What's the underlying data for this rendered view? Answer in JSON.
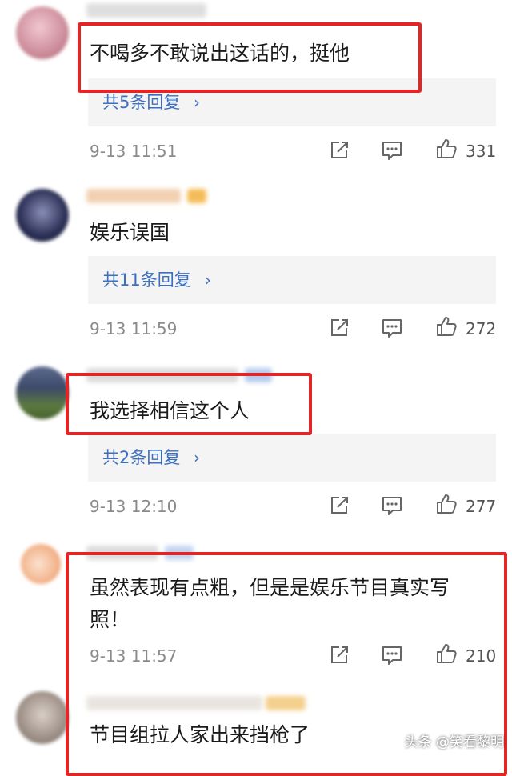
{
  "comments": [
    {
      "text": "不喝多不敢说出这话的，挺他",
      "reply_label": "共5条回复",
      "timestamp": "9-13 11:51",
      "likes": "331"
    },
    {
      "text": "娱乐误国",
      "reply_label": "共11条回复",
      "timestamp": "9-13 11:59",
      "likes": "272"
    },
    {
      "text": "我选择相信这个人",
      "reply_label": "共2条回复",
      "timestamp": "9-13 12:10",
      "likes": "277"
    },
    {
      "text_line1": "虽然表现有点粗，但是是娱乐节目真实写",
      "text_line2": "照！",
      "timestamp": "9-13 11:57",
      "likes": "210"
    },
    {
      "text": "节目组拉人家出来挡枪了"
    }
  ],
  "reply_chevron": "›",
  "watermark": "头条 @笑看黎明",
  "icons": [
    "share-icon",
    "comment-icon",
    "thumbs-up-icon"
  ],
  "colors": {
    "highlight_border": "#e32525",
    "reply_link": "#3b6fc0",
    "reply_bg": "#f4f4f5"
  }
}
